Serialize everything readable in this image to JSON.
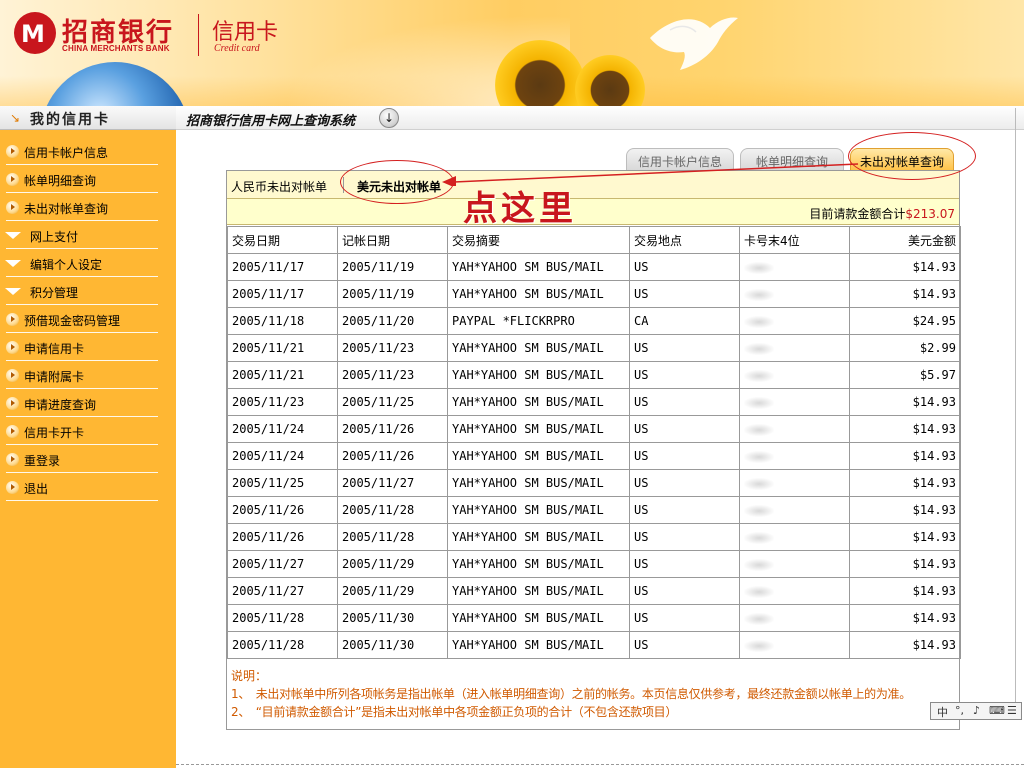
{
  "header": {
    "bank_name": "招商银行",
    "bank_name_en": "CHINA MERCHANTS BANK",
    "card_title": "信用卡",
    "card_title_en": "Credit card",
    "logo_glyph": "M"
  },
  "sidebar": {
    "header_label": "我的信用卡",
    "items": [
      {
        "label": "信用卡帐户信息",
        "icon": "arrow-bullet-icon"
      },
      {
        "label": "帐单明细查询",
        "icon": "arrow-bullet-icon"
      },
      {
        "label": "未出对帐单查询",
        "icon": "arrow-bullet-icon"
      },
      {
        "label": "网上支付",
        "icon": "chevron-down-icon"
      },
      {
        "label": "编辑个人设定",
        "icon": "chevron-down-icon"
      },
      {
        "label": "积分管理",
        "icon": "chevron-down-icon"
      },
      {
        "label": "预借现金密码管理",
        "icon": "arrow-bullet-icon"
      },
      {
        "label": "申请信用卡",
        "icon": "arrow-bullet-icon"
      },
      {
        "label": "申请附属卡",
        "icon": "arrow-bullet-icon"
      },
      {
        "label": "申请进度查询",
        "icon": "arrow-bullet-icon"
      },
      {
        "label": "信用卡开卡",
        "icon": "arrow-bullet-icon"
      },
      {
        "label": "重登录",
        "icon": "arrow-bullet-icon"
      },
      {
        "label": "退出",
        "icon": "arrow-bullet-icon"
      }
    ]
  },
  "system_title": "招商银行信用卡网上查询系统",
  "tabs": [
    {
      "label": "信用卡帐户信息",
      "active": false
    },
    {
      "label": "帐单明细查询",
      "active": false
    },
    {
      "label": "未出对帐单查询",
      "active": true
    }
  ],
  "subtabs": {
    "rmb": "人民币未出对帐单",
    "usd": "美元未出对帐单"
  },
  "total": {
    "label": "目前请款金额合计",
    "amount": "$213.07"
  },
  "table": {
    "headers": [
      "交易日期",
      "记帐日期",
      "交易摘要",
      "交易地点",
      "卡号末4位",
      "美元金额"
    ],
    "rows": [
      [
        "2005/11/17",
        "2005/11/19",
        "YAH*YAHOO SM BUS/MAIL",
        "US",
        "$14.93"
      ],
      [
        "2005/11/17",
        "2005/11/19",
        "YAH*YAHOO SM BUS/MAIL",
        "US",
        "$14.93"
      ],
      [
        "2005/11/18",
        "2005/11/20",
        "PAYPAL *FLICKRPRO",
        "CA",
        "$24.95"
      ],
      [
        "2005/11/21",
        "2005/11/23",
        "YAH*YAHOO SM BUS/MAIL",
        "US",
        "$2.99"
      ],
      [
        "2005/11/21",
        "2005/11/23",
        "YAH*YAHOO SM BUS/MAIL",
        "US",
        "$5.97"
      ],
      [
        "2005/11/23",
        "2005/11/25",
        "YAH*YAHOO SM BUS/MAIL",
        "US",
        "$14.93"
      ],
      [
        "2005/11/24",
        "2005/11/26",
        "YAH*YAHOO SM BUS/MAIL",
        "US",
        "$14.93"
      ],
      [
        "2005/11/24",
        "2005/11/26",
        "YAH*YAHOO SM BUS/MAIL",
        "US",
        "$14.93"
      ],
      [
        "2005/11/25",
        "2005/11/27",
        "YAH*YAHOO SM BUS/MAIL",
        "US",
        "$14.93"
      ],
      [
        "2005/11/26",
        "2005/11/28",
        "YAH*YAHOO SM BUS/MAIL",
        "US",
        "$14.93"
      ],
      [
        "2005/11/26",
        "2005/11/28",
        "YAH*YAHOO SM BUS/MAIL",
        "US",
        "$14.93"
      ],
      [
        "2005/11/27",
        "2005/11/29",
        "YAH*YAHOO SM BUS/MAIL",
        "US",
        "$14.93"
      ],
      [
        "2005/11/27",
        "2005/11/29",
        "YAH*YAHOO SM BUS/MAIL",
        "US",
        "$14.93"
      ],
      [
        "2005/11/28",
        "2005/11/30",
        "YAH*YAHOO SM BUS/MAIL",
        "US",
        "$14.93"
      ],
      [
        "2005/11/28",
        "2005/11/30",
        "YAH*YAHOO SM BUS/MAIL",
        "US",
        "$14.93"
      ]
    ]
  },
  "notes": {
    "title": "说明：",
    "lines": [
      "1、　未出对帐单中所列各项帐务是指出帐单（进入帐单明细查询）之前的帐务。本页信息仅供参考，最终还款金额以帐单上的为准。",
      "2、　“目前请款金额合计”是指未出对帐单中各项金额正负项的合计（不包含还款项目）"
    ]
  },
  "annotation": {
    "text": "点这里"
  },
  "ime": {
    "items": [
      "中",
      "°,",
      "♪",
      "⌨",
      "☰"
    ]
  },
  "colors": {
    "brand_red": "#c8161d",
    "sidebar_orange": "#ffb733",
    "note_orange": "#d05a00",
    "annotation_red": "#d42020"
  }
}
